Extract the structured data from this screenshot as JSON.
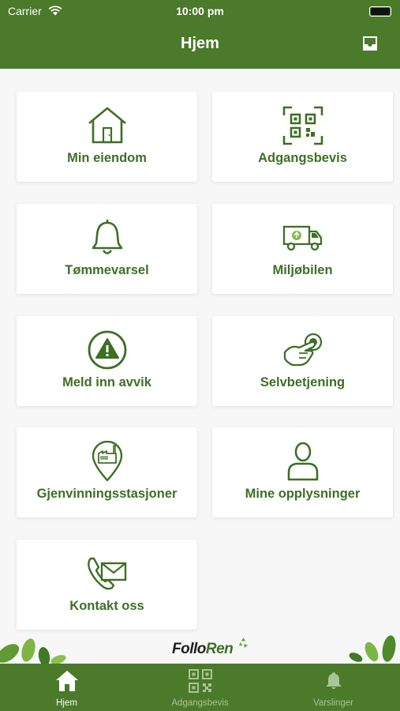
{
  "status_bar": {
    "carrier": "Carrier",
    "time": "10:00 pm"
  },
  "nav": {
    "title": "Hjem",
    "inbox_icon": "inbox-icon"
  },
  "tiles": [
    {
      "label": "Min eiendom",
      "icon": "house-icon"
    },
    {
      "label": "Adgangsbevis",
      "icon": "qr-code-icon"
    },
    {
      "label": "Tømmevarsel",
      "icon": "bell-icon"
    },
    {
      "label": "Miljøbilen",
      "icon": "truck-icon"
    },
    {
      "label": "Meld inn avvik",
      "icon": "warning-icon"
    },
    {
      "label": "Selvbetjening",
      "icon": "touch-icon"
    },
    {
      "label": "Gjenvinningsstasjoner",
      "icon": "location-pin-icon"
    },
    {
      "label": "Mine opplysninger",
      "icon": "person-icon"
    },
    {
      "label": "Kontakt oss",
      "icon": "contact-icon"
    }
  ],
  "logo": {
    "part1": "Follo",
    "part2": "Ren"
  },
  "tabbar": {
    "items": [
      {
        "label": "Hjem",
        "icon": "home-icon",
        "active": true
      },
      {
        "label": "Adgangsbevis",
        "icon": "qr-code-icon",
        "active": false
      },
      {
        "label": "Varslinger",
        "icon": "bell-icon",
        "active": false
      }
    ]
  },
  "colors": {
    "brand_green": "#4a7a2a",
    "label_green": "#3e6f25",
    "background": "#f7f7f7"
  }
}
